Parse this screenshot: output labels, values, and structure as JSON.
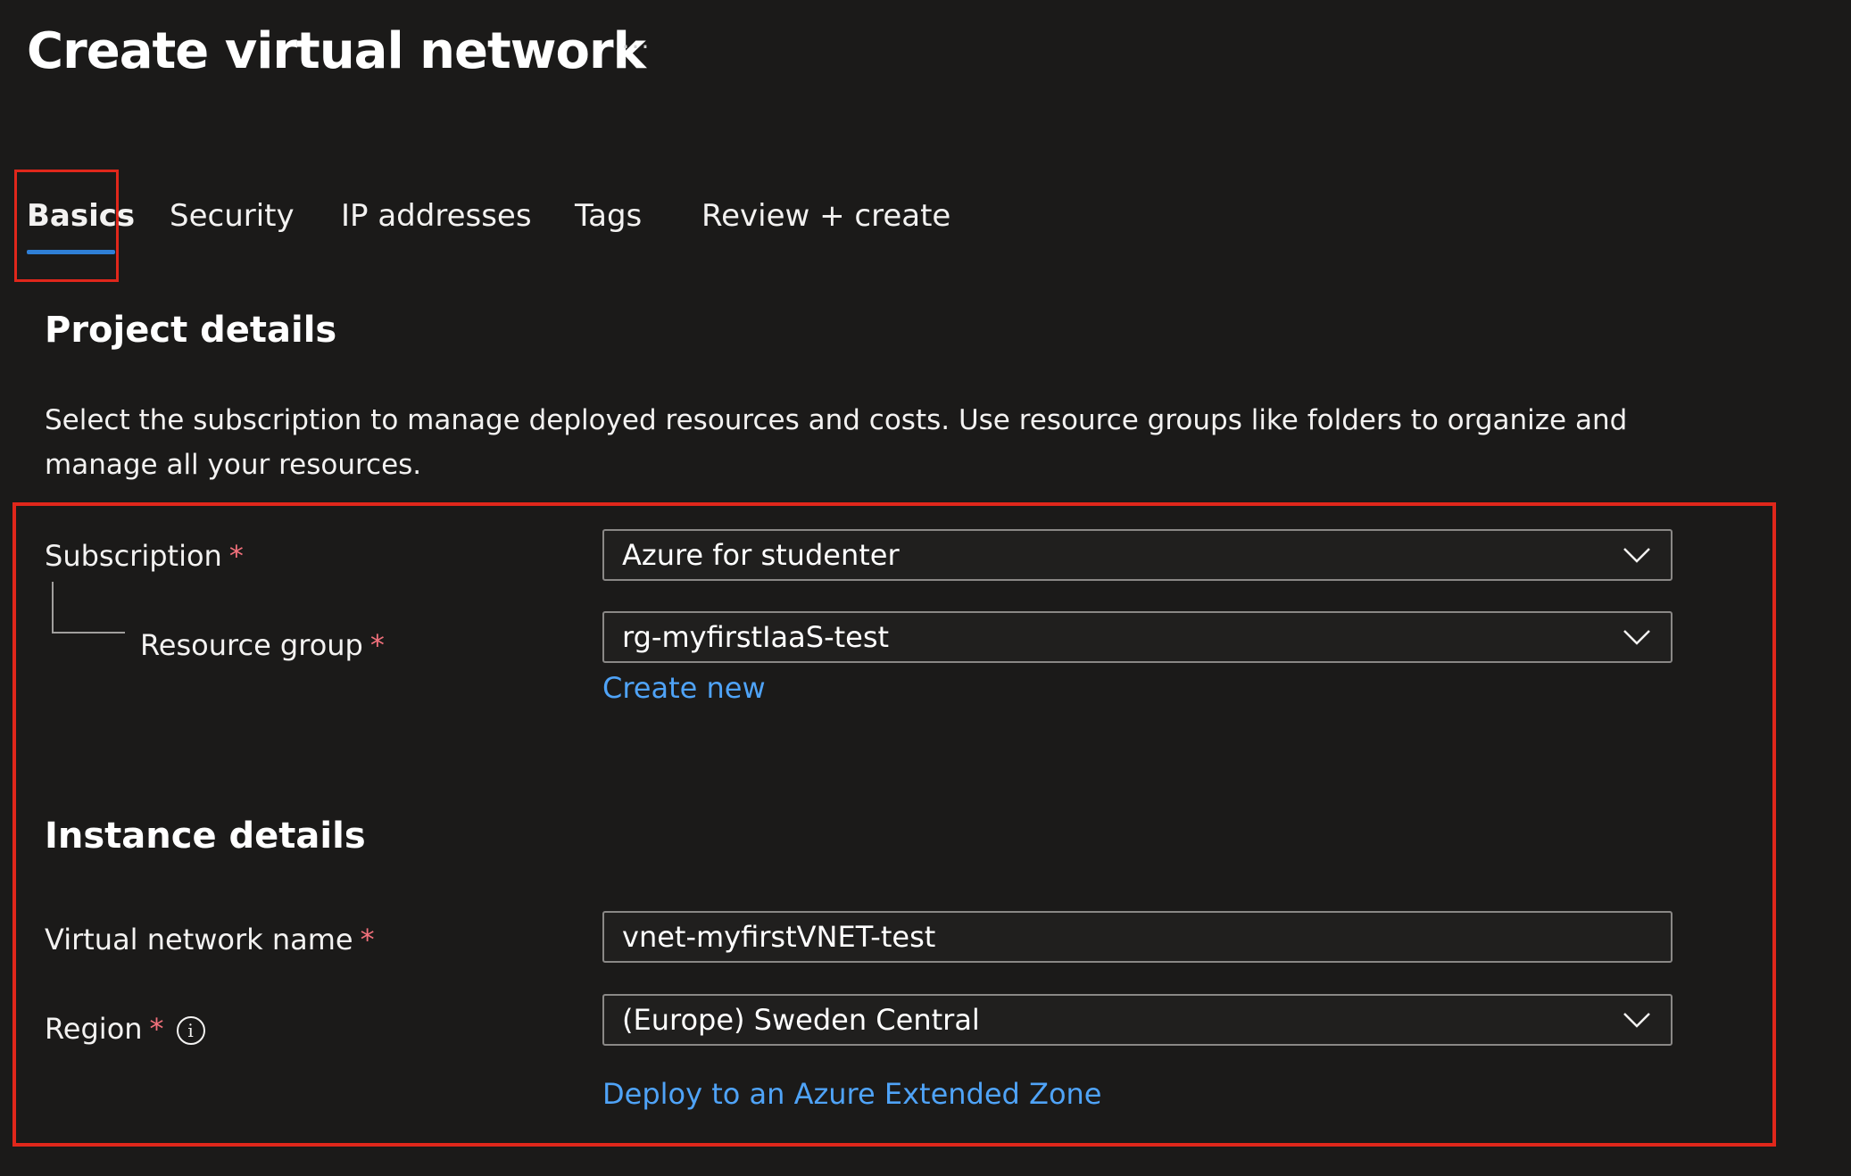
{
  "header": {
    "title": "Create virtual network",
    "more_label": "···"
  },
  "tabs": [
    {
      "label": "Basics",
      "selected": true
    },
    {
      "label": "Security"
    },
    {
      "label": "IP addresses"
    },
    {
      "label": "Tags"
    },
    {
      "label": "Review + create"
    }
  ],
  "project_details": {
    "heading": "Project details",
    "description": "Select the subscription to manage deployed resources and costs. Use resource groups like folders to organize and manage all your resources.",
    "subscription": {
      "label": "Subscription",
      "required": "*",
      "value": "Azure for studenter"
    },
    "resource_group": {
      "label": "Resource group",
      "required": "*",
      "value": "rg-myfirstIaaS-test",
      "create_new_link": "Create new"
    }
  },
  "instance_details": {
    "heading": "Instance details",
    "vnet_name": {
      "label": "Virtual network name",
      "required": "*",
      "value": "vnet-myfirstVNET-test"
    },
    "region": {
      "label": "Region",
      "required": "*",
      "info_icon": "i",
      "value": "(Europe) Sweden Central",
      "extended_zone_link": "Deploy to an Azure Extended Zone"
    }
  },
  "colors": {
    "background": "#1b1a19",
    "highlight": "#e0271b",
    "accent": "#2f7fd6",
    "link": "#4fa3f7",
    "required": "#f1707b"
  },
  "icons": {
    "more": "more-icon",
    "dropdown": "chevron-down-icon",
    "info": "info-icon"
  }
}
